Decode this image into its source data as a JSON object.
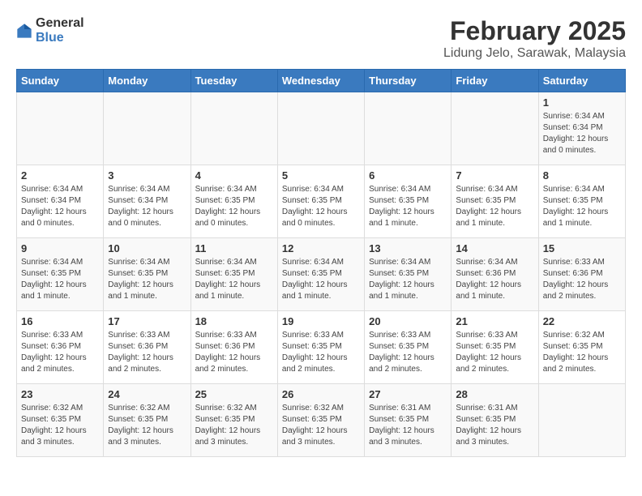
{
  "logo": {
    "general": "General",
    "blue": "Blue"
  },
  "title": "February 2025",
  "subtitle": "Lidung Jelo, Sarawak, Malaysia",
  "days_of_week": [
    "Sunday",
    "Monday",
    "Tuesday",
    "Wednesday",
    "Thursday",
    "Friday",
    "Saturday"
  ],
  "weeks": [
    [
      {
        "day": "",
        "info": ""
      },
      {
        "day": "",
        "info": ""
      },
      {
        "day": "",
        "info": ""
      },
      {
        "day": "",
        "info": ""
      },
      {
        "day": "",
        "info": ""
      },
      {
        "day": "",
        "info": ""
      },
      {
        "day": "1",
        "info": "Sunrise: 6:34 AM\nSunset: 6:34 PM\nDaylight: 12 hours\nand 0 minutes."
      }
    ],
    [
      {
        "day": "2",
        "info": "Sunrise: 6:34 AM\nSunset: 6:34 PM\nDaylight: 12 hours\nand 0 minutes."
      },
      {
        "day": "3",
        "info": "Sunrise: 6:34 AM\nSunset: 6:34 PM\nDaylight: 12 hours\nand 0 minutes."
      },
      {
        "day": "4",
        "info": "Sunrise: 6:34 AM\nSunset: 6:35 PM\nDaylight: 12 hours\nand 0 minutes."
      },
      {
        "day": "5",
        "info": "Sunrise: 6:34 AM\nSunset: 6:35 PM\nDaylight: 12 hours\nand 0 minutes."
      },
      {
        "day": "6",
        "info": "Sunrise: 6:34 AM\nSunset: 6:35 PM\nDaylight: 12 hours\nand 1 minute."
      },
      {
        "day": "7",
        "info": "Sunrise: 6:34 AM\nSunset: 6:35 PM\nDaylight: 12 hours\nand 1 minute."
      },
      {
        "day": "8",
        "info": "Sunrise: 6:34 AM\nSunset: 6:35 PM\nDaylight: 12 hours\nand 1 minute."
      }
    ],
    [
      {
        "day": "9",
        "info": "Sunrise: 6:34 AM\nSunset: 6:35 PM\nDaylight: 12 hours\nand 1 minute."
      },
      {
        "day": "10",
        "info": "Sunrise: 6:34 AM\nSunset: 6:35 PM\nDaylight: 12 hours\nand 1 minute."
      },
      {
        "day": "11",
        "info": "Sunrise: 6:34 AM\nSunset: 6:35 PM\nDaylight: 12 hours\nand 1 minute."
      },
      {
        "day": "12",
        "info": "Sunrise: 6:34 AM\nSunset: 6:35 PM\nDaylight: 12 hours\nand 1 minute."
      },
      {
        "day": "13",
        "info": "Sunrise: 6:34 AM\nSunset: 6:35 PM\nDaylight: 12 hours\nand 1 minute."
      },
      {
        "day": "14",
        "info": "Sunrise: 6:34 AM\nSunset: 6:36 PM\nDaylight: 12 hours\nand 1 minute."
      },
      {
        "day": "15",
        "info": "Sunrise: 6:33 AM\nSunset: 6:36 PM\nDaylight: 12 hours\nand 2 minutes."
      }
    ],
    [
      {
        "day": "16",
        "info": "Sunrise: 6:33 AM\nSunset: 6:36 PM\nDaylight: 12 hours\nand 2 minutes."
      },
      {
        "day": "17",
        "info": "Sunrise: 6:33 AM\nSunset: 6:36 PM\nDaylight: 12 hours\nand 2 minutes."
      },
      {
        "day": "18",
        "info": "Sunrise: 6:33 AM\nSunset: 6:36 PM\nDaylight: 12 hours\nand 2 minutes."
      },
      {
        "day": "19",
        "info": "Sunrise: 6:33 AM\nSunset: 6:35 PM\nDaylight: 12 hours\nand 2 minutes."
      },
      {
        "day": "20",
        "info": "Sunrise: 6:33 AM\nSunset: 6:35 PM\nDaylight: 12 hours\nand 2 minutes."
      },
      {
        "day": "21",
        "info": "Sunrise: 6:33 AM\nSunset: 6:35 PM\nDaylight: 12 hours\nand 2 minutes."
      },
      {
        "day": "22",
        "info": "Sunrise: 6:32 AM\nSunset: 6:35 PM\nDaylight: 12 hours\nand 2 minutes."
      }
    ],
    [
      {
        "day": "23",
        "info": "Sunrise: 6:32 AM\nSunset: 6:35 PM\nDaylight: 12 hours\nand 3 minutes."
      },
      {
        "day": "24",
        "info": "Sunrise: 6:32 AM\nSunset: 6:35 PM\nDaylight: 12 hours\nand 3 minutes."
      },
      {
        "day": "25",
        "info": "Sunrise: 6:32 AM\nSunset: 6:35 PM\nDaylight: 12 hours\nand 3 minutes."
      },
      {
        "day": "26",
        "info": "Sunrise: 6:32 AM\nSunset: 6:35 PM\nDaylight: 12 hours\nand 3 minutes."
      },
      {
        "day": "27",
        "info": "Sunrise: 6:31 AM\nSunset: 6:35 PM\nDaylight: 12 hours\nand 3 minutes."
      },
      {
        "day": "28",
        "info": "Sunrise: 6:31 AM\nSunset: 6:35 PM\nDaylight: 12 hours\nand 3 minutes."
      },
      {
        "day": "",
        "info": ""
      }
    ]
  ]
}
